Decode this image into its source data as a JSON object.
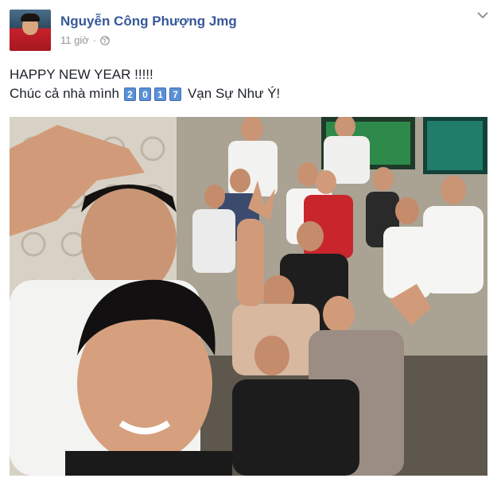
{
  "post": {
    "author": "Nguyễn Công Phượng Jmg",
    "time": "11 giờ",
    "separator": "·",
    "privacy_icon": "globe-icon",
    "options_icon": "chevron-down-icon",
    "text": {
      "line1": "HAPPY NEW YEAR !!!!!",
      "line2_prefix": "Chúc cả nhà mình",
      "digits": [
        "2",
        "0",
        "1",
        "7"
      ],
      "line2_suffix": "Vạn Sự Như Ý!"
    },
    "photo": {
      "description_icon": "group-selfie-photo"
    }
  },
  "colors": {
    "author_link": "#365899",
    "meta_text": "#90949c",
    "body_text": "#1d2129",
    "keycap_digit": "#5a90d6"
  }
}
